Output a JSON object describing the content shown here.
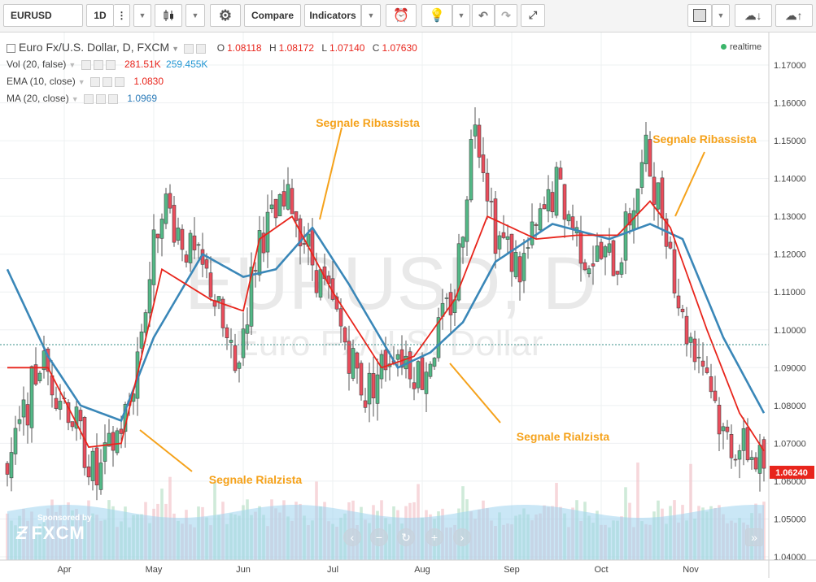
{
  "toolbar": {
    "symbol": "EURUSD",
    "interval": "1D",
    "compare_label": "Compare",
    "indicators_label": "Indicators"
  },
  "legend": {
    "main_title": "Euro Fx/U.S. Dollar, D, FXCM",
    "o_label": "O",
    "o_value": "1.08118",
    "h_label": "H",
    "h_value": "1.08172",
    "l_label": "L",
    "l_value": "1.07140",
    "c_label": "C",
    "c_value": "1.07630",
    "vol_label": "Vol (20, false)",
    "vol_value1": "281.51K",
    "vol_value2": "259.455K",
    "ema_label": "EMA (10, close)",
    "ema_value": "1.0830",
    "ma_label": "MA (20, close)",
    "ma_value": "1.0969",
    "realtime": "realtime"
  },
  "watermark": {
    "line1": "EURUSD, D",
    "line2": "Euro Fx/U.S. Dollar"
  },
  "sponsor": {
    "line1": "Sponsored by",
    "brand": "FXCM"
  },
  "annotations": [
    {
      "text": "Segnale Ribassista"
    },
    {
      "text": "Segnale Ribassista"
    },
    {
      "text": "Segnale Rialzista"
    },
    {
      "text": "Segnale Rialzista"
    }
  ],
  "colors": {
    "up": "#53b987",
    "down": "#eb4d5c",
    "ema": "#e8251c",
    "ma": "#3a87b8",
    "annotation": "#f5a21b",
    "price_tag": "#e8251c"
  },
  "chart_data": {
    "type": "candlestick",
    "symbol": "EURUSD",
    "timeframe": "D",
    "ylim": [
      1.04,
      1.175
    ],
    "y_ticks": [
      "1.17000",
      "1.16000",
      "1.15000",
      "1.14000",
      "1.13000",
      "1.12000",
      "1.11000",
      "1.10000",
      "1.09000",
      "1.08000",
      "1.07000",
      "1.06000",
      "1.05000",
      "1.04000"
    ],
    "x_ticks": [
      "Apr",
      "May",
      "Jun",
      "Jul",
      "Aug",
      "Sep",
      "Oct",
      "Nov"
    ],
    "last_price": "1.06240",
    "close_anchors": [
      [
        0,
        1.062
      ],
      [
        8,
        1.092
      ],
      [
        15,
        1.08
      ],
      [
        22,
        1.06
      ],
      [
        30,
        1.08
      ],
      [
        38,
        1.135
      ],
      [
        45,
        1.12
      ],
      [
        50,
        1.112
      ],
      [
        56,
        1.088
      ],
      [
        62,
        1.125
      ],
      [
        70,
        1.134
      ],
      [
        75,
        1.118
      ],
      [
        82,
        1.1
      ],
      [
        88,
        1.083
      ],
      [
        95,
        1.096
      ],
      [
        102,
        1.088
      ],
      [
        110,
        1.11
      ],
      [
        115,
        1.158
      ],
      [
        120,
        1.126
      ],
      [
        126,
        1.116
      ],
      [
        135,
        1.138
      ],
      [
        142,
        1.12
      ],
      [
        150,
        1.118
      ],
      [
        157,
        1.146
      ],
      [
        162,
        1.128
      ],
      [
        166,
        1.102
      ],
      [
        172,
        1.09
      ],
      [
        176,
        1.072
      ],
      [
        182,
        1.068
      ],
      [
        186,
        1.064
      ]
    ],
    "ema_anchors": [
      [
        0,
        1.09
      ],
      [
        10,
        1.09
      ],
      [
        20,
        1.069
      ],
      [
        28,
        1.07
      ],
      [
        38,
        1.116
      ],
      [
        50,
        1.108
      ],
      [
        58,
        1.105
      ],
      [
        62,
        1.124
      ],
      [
        70,
        1.13
      ],
      [
        80,
        1.11
      ],
      [
        92,
        1.09
      ],
      [
        100,
        1.093
      ],
      [
        110,
        1.108
      ],
      [
        118,
        1.13
      ],
      [
        130,
        1.124
      ],
      [
        140,
        1.125
      ],
      [
        150,
        1.125
      ],
      [
        158,
        1.134
      ],
      [
        163,
        1.127
      ],
      [
        172,
        1.1
      ],
      [
        180,
        1.078
      ],
      [
        186,
        1.068
      ]
    ],
    "ma_anchors": [
      [
        0,
        1.116
      ],
      [
        10,
        1.093
      ],
      [
        18,
        1.08
      ],
      [
        28,
        1.076
      ],
      [
        36,
        1.098
      ],
      [
        48,
        1.12
      ],
      [
        58,
        1.114
      ],
      [
        66,
        1.116
      ],
      [
        75,
        1.127
      ],
      [
        84,
        1.112
      ],
      [
        96,
        1.09
      ],
      [
        104,
        1.094
      ],
      [
        112,
        1.102
      ],
      [
        120,
        1.118
      ],
      [
        134,
        1.128
      ],
      [
        148,
        1.124
      ],
      [
        158,
        1.128
      ],
      [
        166,
        1.124
      ],
      [
        176,
        1.098
      ],
      [
        186,
        1.078
      ]
    ],
    "volume_avg_level": 0.6
  }
}
